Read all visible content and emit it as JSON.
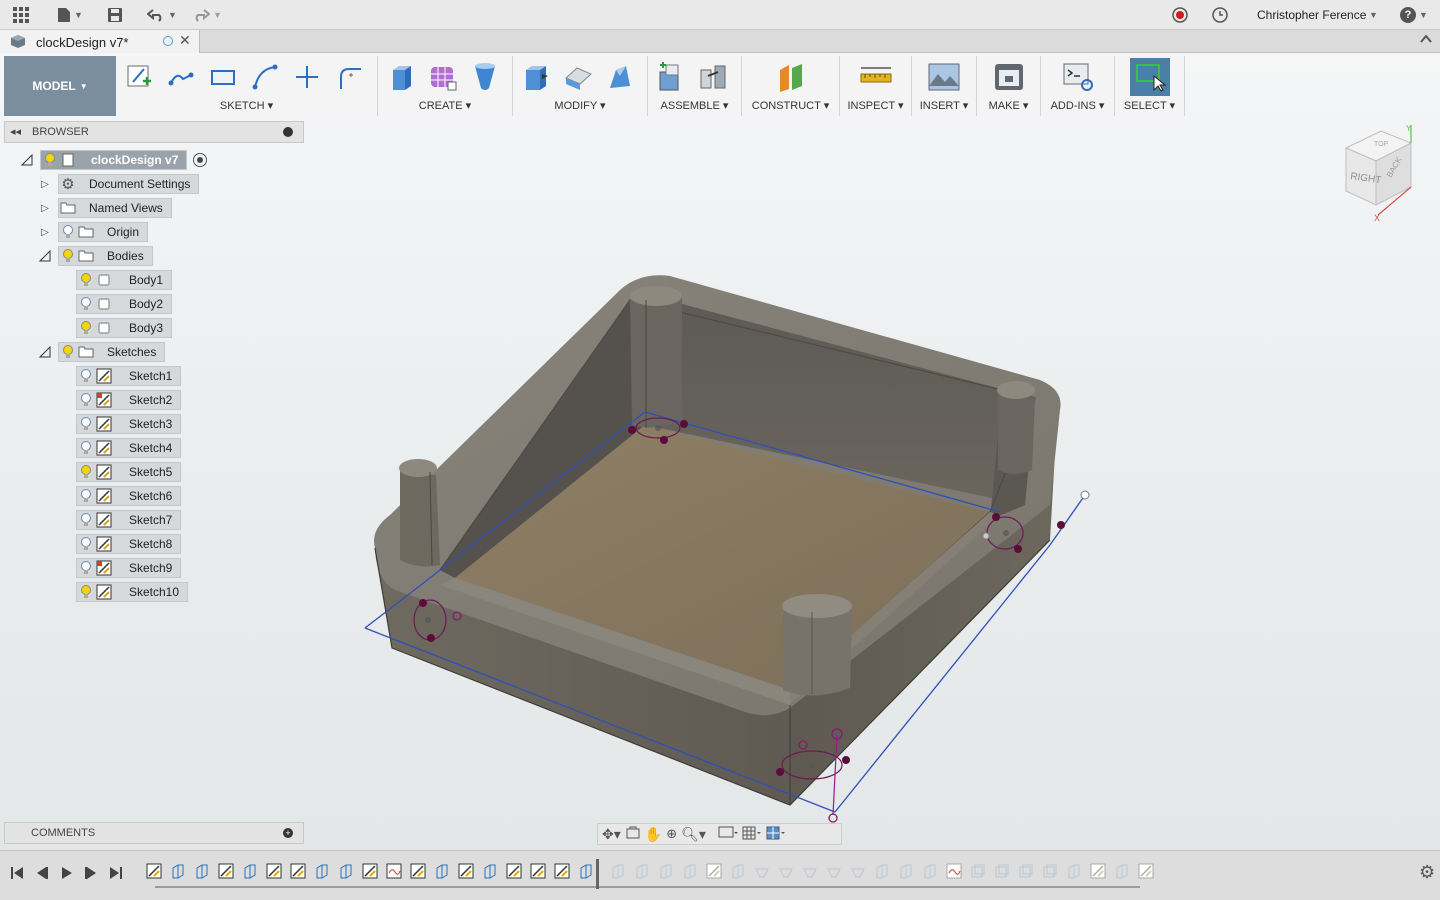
{
  "titlebar": {
    "user_name": "Christopher Ference",
    "help_label": "?"
  },
  "tab": {
    "title": "clockDesign v7*"
  },
  "toolbar": {
    "workspace": "MODEL",
    "groups": [
      {
        "label": "SKETCH",
        "icons": [
          "create-sketch-icon",
          "line-icon",
          "rectangle-icon",
          "arc-icon",
          "point-icon",
          "fillet-sketch-icon"
        ]
      },
      {
        "label": "CREATE",
        "icons": [
          "extrude-icon",
          "form-icon",
          "revolve-icon"
        ]
      },
      {
        "label": "MODIFY",
        "icons": [
          "press-pull-icon",
          "fillet-icon",
          "chamfer-icon"
        ]
      },
      {
        "label": "ASSEMBLE",
        "icons": [
          "new-component-icon",
          "joint-icon"
        ]
      },
      {
        "label": "CONSTRUCT",
        "icons": [
          "offset-plane-icon"
        ]
      },
      {
        "label": "INSPECT",
        "icons": [
          "measure-icon"
        ]
      },
      {
        "label": "INSERT",
        "icons": [
          "insert-image-icon"
        ]
      },
      {
        "label": "MAKE",
        "icons": [
          "3d-print-icon"
        ]
      },
      {
        "label": "ADD-INS",
        "icons": [
          "scripts-icon"
        ]
      },
      {
        "label": "SELECT",
        "icons": [
          "select-icon"
        ]
      }
    ]
  },
  "browser": {
    "title": "BROWSER",
    "root": "clockDesign v7",
    "items": [
      {
        "label": "Document Settings"
      },
      {
        "label": "Named Views"
      },
      {
        "label": "Origin"
      },
      {
        "label": "Bodies"
      },
      {
        "label": "Body1"
      },
      {
        "label": "Body2"
      },
      {
        "label": "Body3"
      },
      {
        "label": "Sketches"
      },
      {
        "label": "Sketch1"
      },
      {
        "label": "Sketch2"
      },
      {
        "label": "Sketch3"
      },
      {
        "label": "Sketch4"
      },
      {
        "label": "Sketch5"
      },
      {
        "label": "Sketch6"
      },
      {
        "label": "Sketch7"
      },
      {
        "label": "Sketch8"
      },
      {
        "label": "Sketch9"
      },
      {
        "label": "Sketch10"
      }
    ]
  },
  "comments": {
    "title": "COMMENTS"
  },
  "viewcube": {
    "face_right": "RIGHT",
    "face_back": "BACK",
    "face_top": "TOP"
  },
  "colors": {
    "accent_select": "#4a7fa8",
    "model_button": "#7b8ea0",
    "body_wall": "#7a756b",
    "floor": "#8a7a62",
    "sketch_line": "#2f50b8",
    "sketch_point": "#6b1040"
  }
}
